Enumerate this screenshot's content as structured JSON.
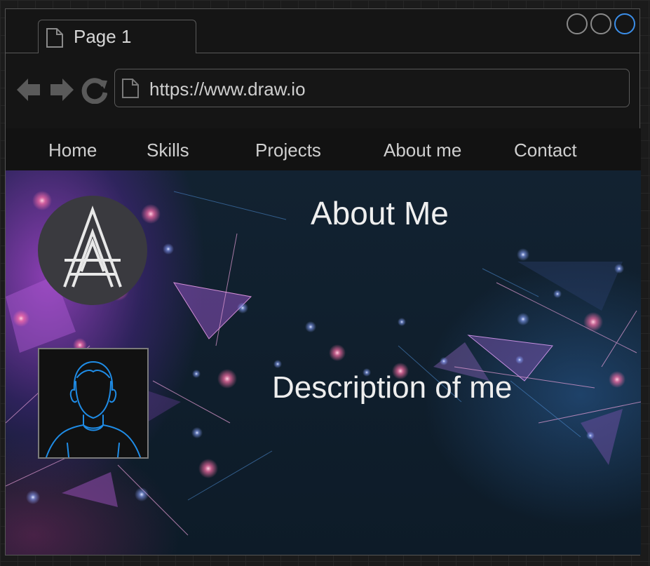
{
  "browser": {
    "tab_title": "Page 1",
    "url": "https://www.draw.io",
    "controls": [
      "back-icon",
      "forward-icon",
      "reload-icon"
    ],
    "accent": "#3b8ee8"
  },
  "nav": {
    "items": [
      {
        "label": "Home"
      },
      {
        "label": "Skills"
      },
      {
        "label": "Projects"
      },
      {
        "label": "About me"
      },
      {
        "label": "Contact"
      }
    ]
  },
  "hero": {
    "title": "About Me",
    "description": "Description of me",
    "logo": "aa-monogram-logo",
    "avatar": "user-avatar-icon",
    "avatar_color": "#1f8ce6"
  }
}
